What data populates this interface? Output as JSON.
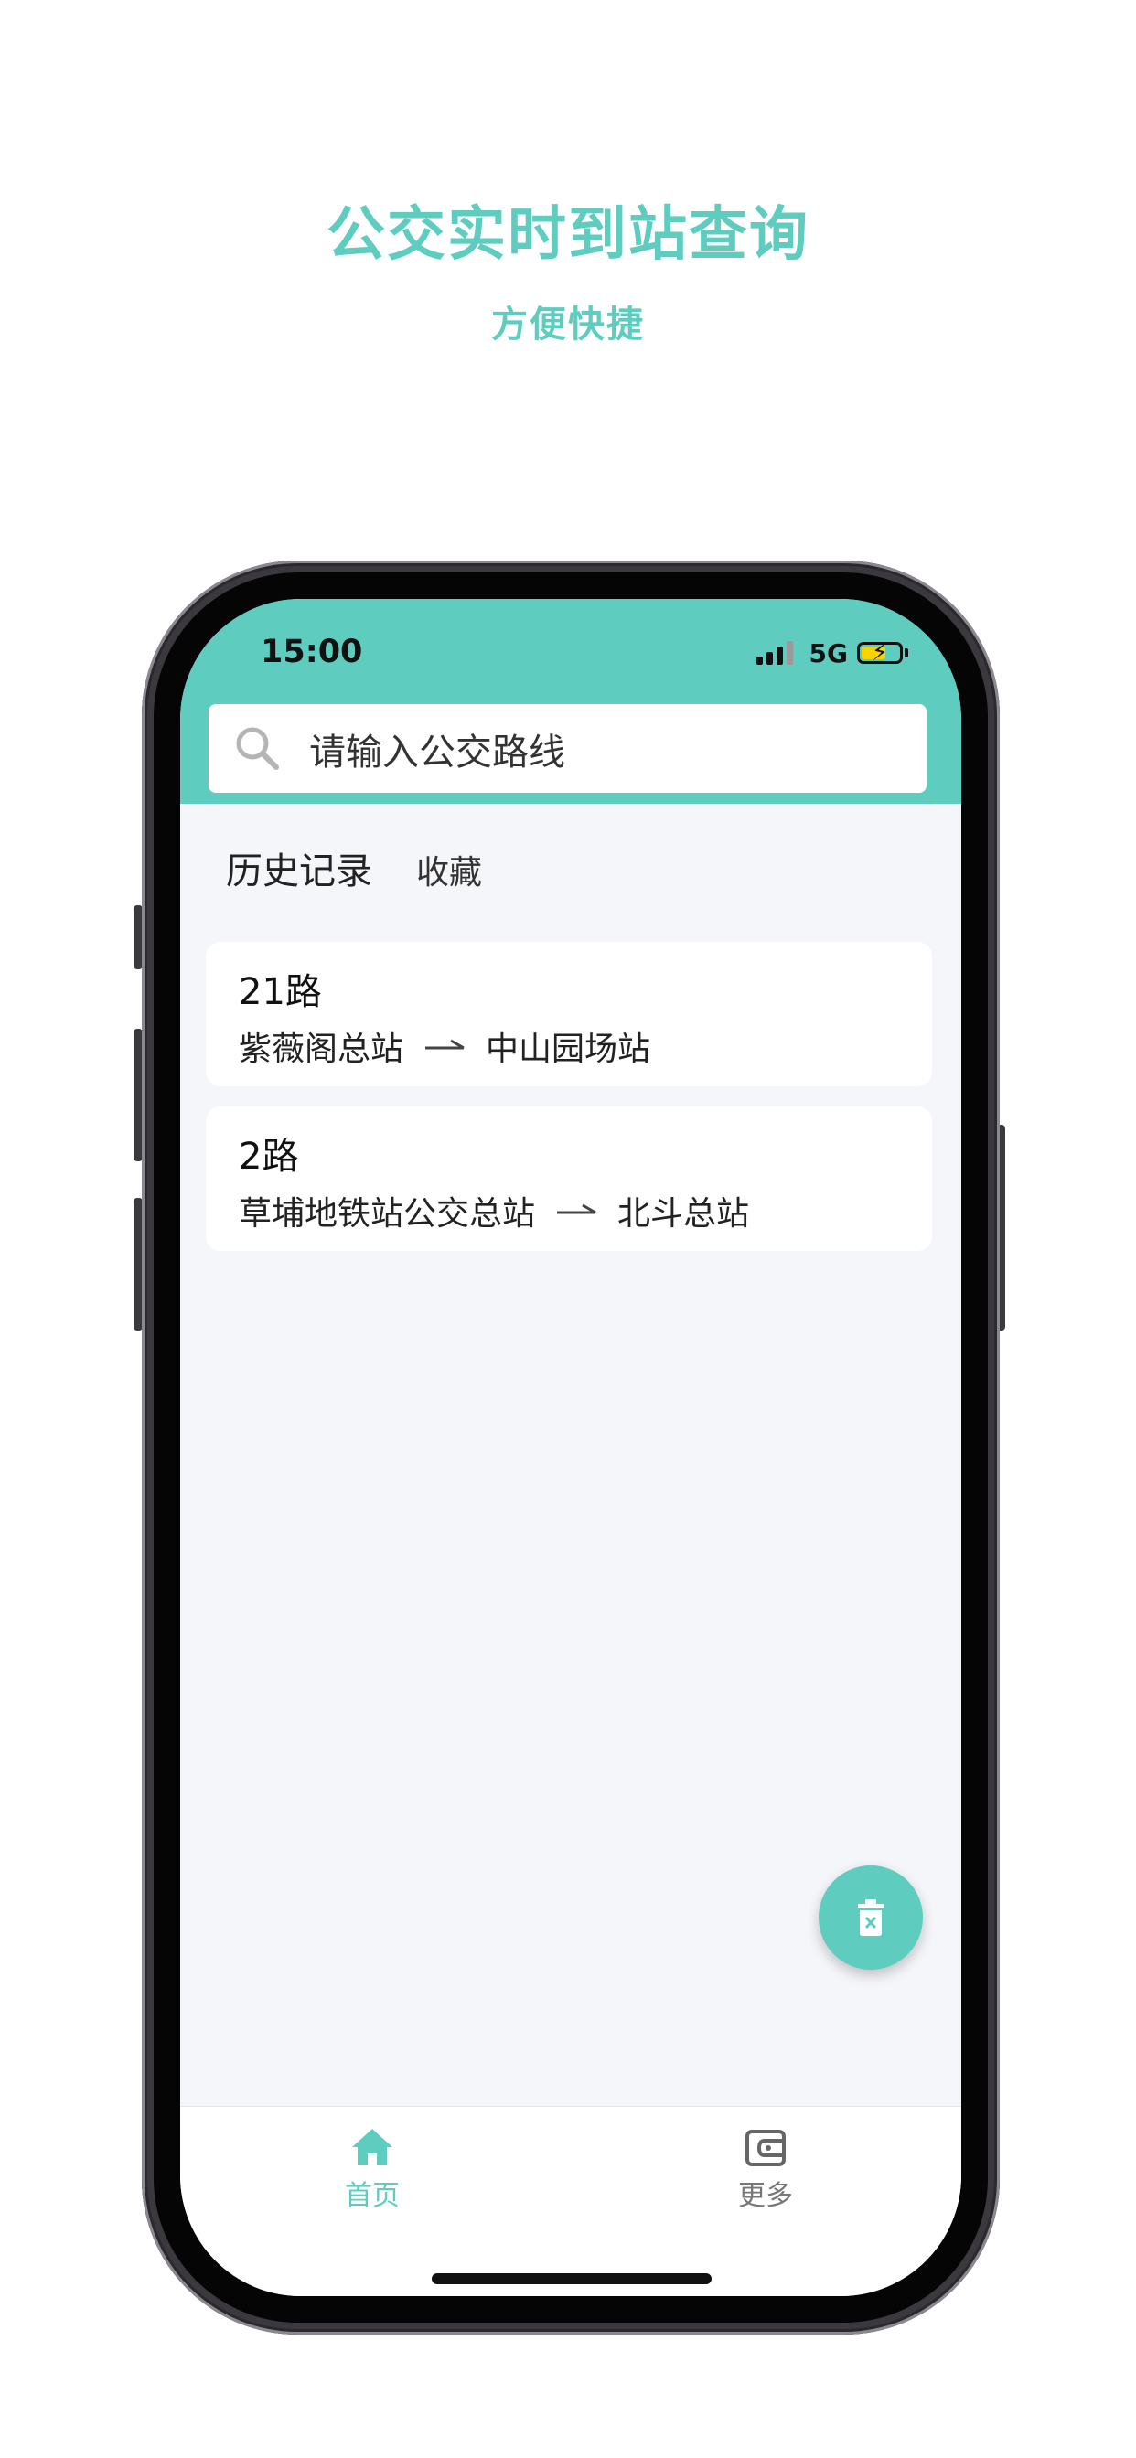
{
  "promo": {
    "title": "公交实时到站查询",
    "subtitle": "方便快捷"
  },
  "status_bar": {
    "time": "15:00",
    "network": "5G",
    "battery_charging": true
  },
  "search": {
    "placeholder": "请输入公交路线",
    "icon": "search-icon"
  },
  "tabs": {
    "history": "历史记录",
    "favorites": "收藏"
  },
  "routes": [
    {
      "name": "21路",
      "from": "紫薇阁总站",
      "to": "中山园场站"
    },
    {
      "name": "2路",
      "from": "草埔地铁站公交总站",
      "to": "北斗总站"
    }
  ],
  "fab": {
    "icon": "delete-icon"
  },
  "bottom_nav": {
    "home": {
      "label": "首页",
      "icon": "home-icon",
      "active": true
    },
    "more": {
      "label": "更多",
      "icon": "wallet-icon",
      "active": false
    }
  },
  "colors": {
    "accent": "#5ecdc0",
    "background": "#f5f6fa",
    "inactive": "#777777"
  }
}
